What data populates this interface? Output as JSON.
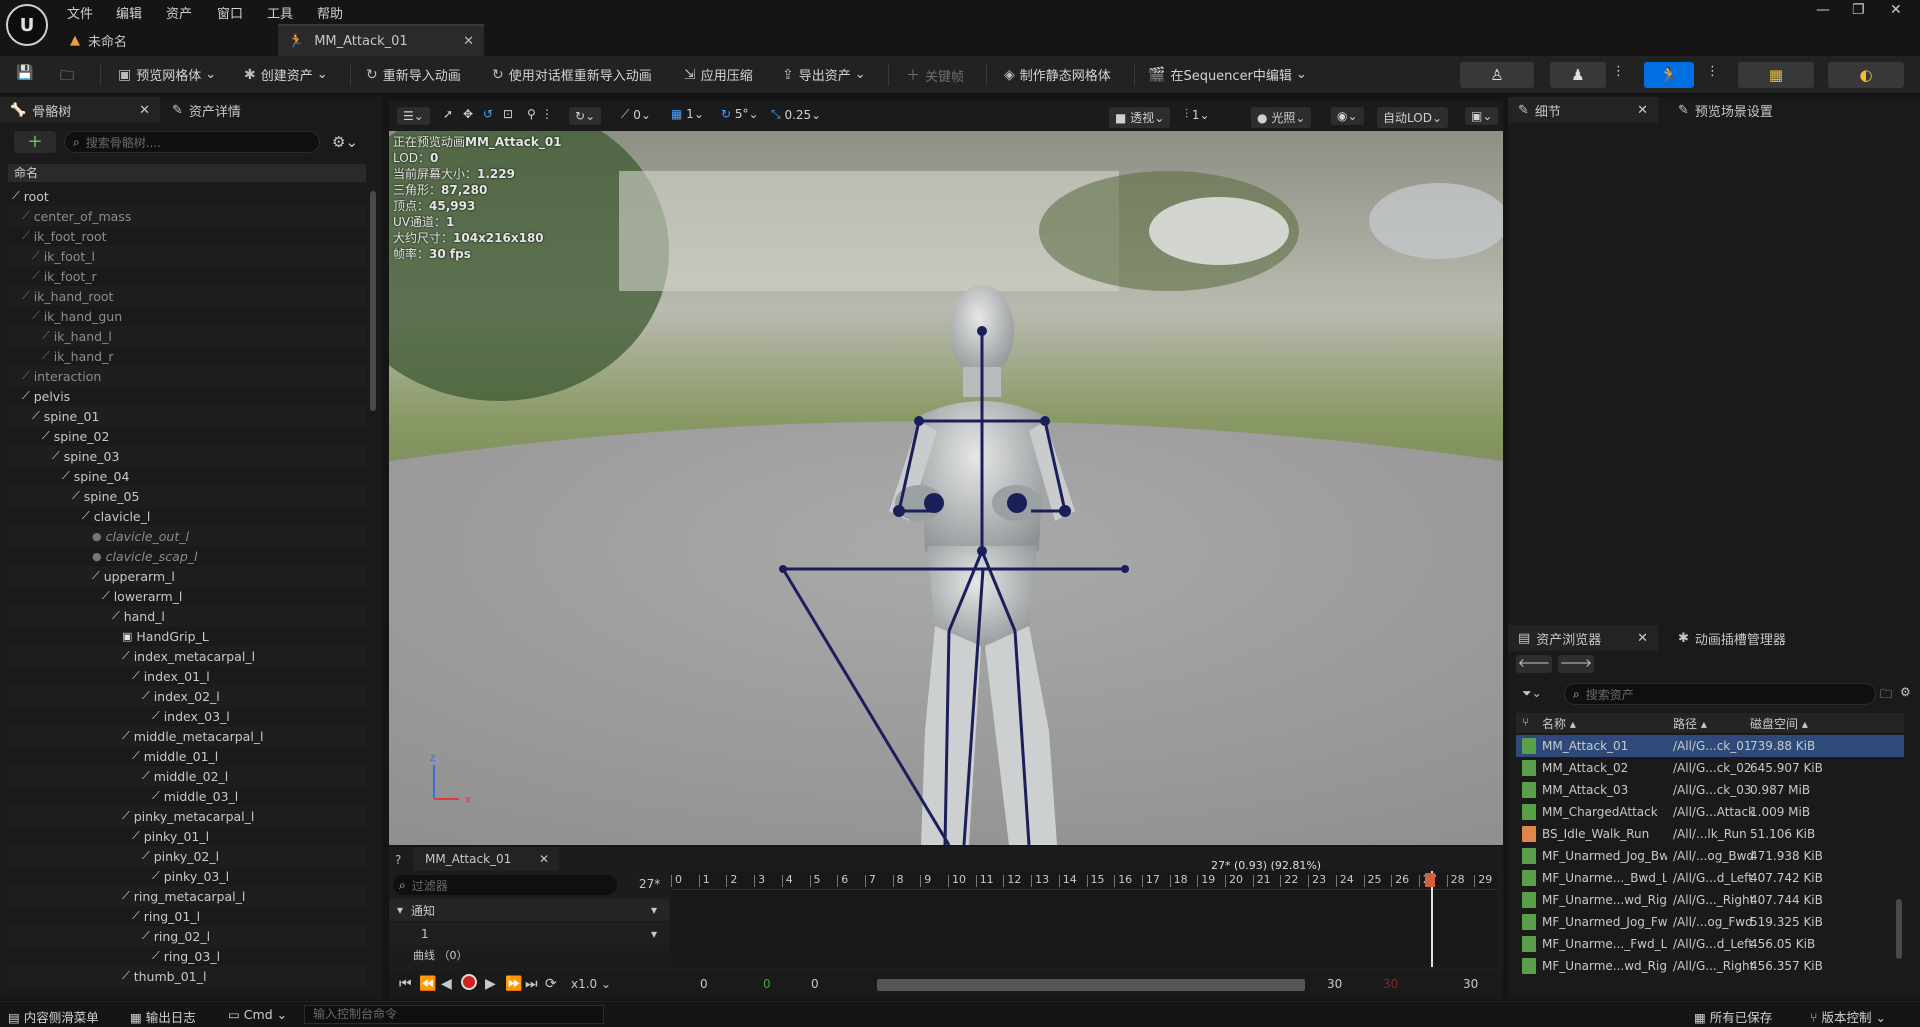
{
  "menu": [
    "文件",
    "编辑",
    "资产",
    "窗口",
    "工具",
    "帮助"
  ],
  "tabs": {
    "untitled": "未命名",
    "asset": "MM_Attack_01"
  },
  "toolbar": {
    "preview_mesh": "预览网格体",
    "create_asset": "创建资产",
    "reimport": "重新导入动画",
    "reimport_dialog": "使用对话框重新导入动画",
    "apply_compression": "应用压缩",
    "export_asset": "导出资产",
    "keyframe": "关键帧",
    "make_static_mesh": "制作静态网格体",
    "edit_sequencer": "在Sequencer中编辑"
  },
  "left_panel": {
    "tab_skeleton": "骨骼树",
    "tab_asset_details": "资产详情",
    "search_placeholder": "搜索骨骼树....",
    "column_name": "命名",
    "bones": [
      {
        "name": "root",
        "depth": 0,
        "style": "bone"
      },
      {
        "name": "center_of_mass",
        "depth": 1,
        "style": "grey"
      },
      {
        "name": "ik_foot_root",
        "depth": 1,
        "style": "grey"
      },
      {
        "name": "ik_foot_l",
        "depth": 2,
        "style": "grey"
      },
      {
        "name": "ik_foot_r",
        "depth": 2,
        "style": "grey"
      },
      {
        "name": "ik_hand_root",
        "depth": 1,
        "style": "grey"
      },
      {
        "name": "ik_hand_gun",
        "depth": 2,
        "style": "grey"
      },
      {
        "name": "ik_hand_l",
        "depth": 3,
        "style": "grey"
      },
      {
        "name": "ik_hand_r",
        "depth": 3,
        "style": "grey"
      },
      {
        "name": "interaction",
        "depth": 1,
        "style": "grey"
      },
      {
        "name": "pelvis",
        "depth": 1,
        "style": "bone"
      },
      {
        "name": "spine_01",
        "depth": 2,
        "style": "bone"
      },
      {
        "name": "spine_02",
        "depth": 3,
        "style": "bone"
      },
      {
        "name": "spine_03",
        "depth": 4,
        "style": "bone"
      },
      {
        "name": "spine_04",
        "depth": 5,
        "style": "bone"
      },
      {
        "name": "spine_05",
        "depth": 6,
        "style": "bone"
      },
      {
        "name": "clavicle_l",
        "depth": 7,
        "style": "bone"
      },
      {
        "name": "clavicle_out_l",
        "depth": 8,
        "style": "ital"
      },
      {
        "name": "clavicle_scap_l",
        "depth": 8,
        "style": "ital"
      },
      {
        "name": "upperarm_l",
        "depth": 8,
        "style": "bone"
      },
      {
        "name": "lowerarm_l",
        "depth": 9,
        "style": "bone"
      },
      {
        "name": "hand_l",
        "depth": 10,
        "style": "bone"
      },
      {
        "name": "HandGrip_L",
        "depth": 11,
        "style": "socket"
      },
      {
        "name": "index_metacarpal_l",
        "depth": 11,
        "style": "bone"
      },
      {
        "name": "index_01_l",
        "depth": 12,
        "style": "bone"
      },
      {
        "name": "index_02_l",
        "depth": 13,
        "style": "bone"
      },
      {
        "name": "index_03_l",
        "depth": 14,
        "style": "bone"
      },
      {
        "name": "middle_metacarpal_l",
        "depth": 11,
        "style": "bone"
      },
      {
        "name": "middle_01_l",
        "depth": 12,
        "style": "bone"
      },
      {
        "name": "middle_02_l",
        "depth": 13,
        "style": "bone"
      },
      {
        "name": "middle_03_l",
        "depth": 14,
        "style": "bone"
      },
      {
        "name": "pinky_metacarpal_l",
        "depth": 11,
        "style": "bone"
      },
      {
        "name": "pinky_01_l",
        "depth": 12,
        "style": "bone"
      },
      {
        "name": "pinky_02_l",
        "depth": 13,
        "style": "bone"
      },
      {
        "name": "pinky_03_l",
        "depth": 14,
        "style": "bone"
      },
      {
        "name": "ring_metacarpal_l",
        "depth": 11,
        "style": "bone"
      },
      {
        "name": "ring_01_l",
        "depth": 12,
        "style": "bone"
      },
      {
        "name": "ring_02_l",
        "depth": 13,
        "style": "bone"
      },
      {
        "name": "ring_03_l",
        "depth": 14,
        "style": "bone"
      },
      {
        "name": "thumb_01_l",
        "depth": 11,
        "style": "bone"
      }
    ]
  },
  "viewport_toolbar": {
    "rot_snap_val": "0",
    "grid_val": "1",
    "angle_val": "5°",
    "scale_val": "0.25",
    "perspective": "透视",
    "lod_count": "1",
    "lighting": "光照",
    "auto_lod": "自动LOD"
  },
  "viewport_stats": [
    {
      "label": "正在预览动画",
      "value": "MM_Attack_01"
    },
    {
      "label": "LOD：",
      "value": "0"
    },
    {
      "label": "当前屏幕大小：",
      "value": "1.229"
    },
    {
      "label": "三角形：",
      "value": "87,280"
    },
    {
      "label": "顶点：",
      "value": "45,993"
    },
    {
      "label": "UV通道：",
      "value": "1"
    },
    {
      "label": "大约尺寸：",
      "value": "104x216x180"
    },
    {
      "label": "帧率：",
      "value": "30 fps"
    }
  ],
  "timeline": {
    "tab": "MM_Attack_01",
    "filter_placeholder": "过滤器",
    "frame_field": "27",
    "notify": "通知",
    "notify_track": "1",
    "curves": "曲线 （0）",
    "current": "27* (0.93) (92.81%)",
    "ticks": [
      "0",
      "1",
      "2",
      "3",
      "4",
      "5",
      "6",
      "7",
      "8",
      "9",
      "10",
      "11",
      "12",
      "13",
      "14",
      "15",
      "16",
      "17",
      "18",
      "19",
      "20",
      "21",
      "22",
      "23",
      "24",
      "25",
      "26",
      "27",
      "28",
      "29"
    ],
    "speed": "x1.0",
    "start_a": "0",
    "start_b": "0",
    "start_c": "0",
    "end_a": "30",
    "end_b": "30",
    "end_c": "30"
  },
  "right_panel": {
    "tab_details": "细节",
    "tab_preview_scene": "预览场景设置"
  },
  "asset_browser": {
    "tab": "资产浏览器",
    "tab_notify": "动画插槽管理器",
    "search_placeholder": "搜索资产",
    "columns": {
      "name": "名称",
      "path": "路径",
      "size": "磁盘空间"
    },
    "rows": [
      {
        "name": "MM_Attack_01",
        "path": "/All/G...ck_01",
        "size": "739.88 KiB",
        "type": "anim",
        "selected": true
      },
      {
        "name": "MM_Attack_02",
        "path": "/All/G...ck_02",
        "size": "645.907 KiB",
        "type": "anim"
      },
      {
        "name": "MM_Attack_03",
        "path": "/All/G...ck_03",
        "size": "0.987 MiB",
        "type": "anim"
      },
      {
        "name": "MM_ChargedAttack",
        "path": "/All/G...Attack",
        "size": "1.009 MiB",
        "type": "anim"
      },
      {
        "name": "BS_Idle_Walk_Run",
        "path": "/All/...lk_Run",
        "size": "51.106 KiB",
        "type": "blend"
      },
      {
        "name": "MF_Unarmed_Jog_Bwd",
        "path": "/All/...og_Bwd",
        "size": "471.938 KiB",
        "type": "anim"
      },
      {
        "name": "MF_Unarme..._Bwd_Left",
        "path": "/All/G...d_Left",
        "size": "407.742 KiB",
        "type": "anim"
      },
      {
        "name": "MF_Unarme...wd_Right",
        "path": "/All/G..._Right",
        "size": "407.744 KiB",
        "type": "anim"
      },
      {
        "name": "MF_Unarmed_Jog_Fwd",
        "path": "/All/...og_Fwd",
        "size": "519.325 KiB",
        "type": "anim"
      },
      {
        "name": "MF_Unarme..._Fwd_Left",
        "path": "/All/G...d_Left",
        "size": "456.05 KiB",
        "type": "anim"
      },
      {
        "name": "MF_Unarme...wd_Right",
        "path": "/All/G..._Right",
        "size": "456.357 KiB",
        "type": "anim"
      }
    ]
  },
  "statusbar": {
    "content_drawer": "内容侧滑菜单",
    "output_log": "输出日志",
    "cmd": "Cmd",
    "console_placeholder": "输入控制台命令",
    "all_saved": "所有已保存",
    "source_control": "版本控制"
  },
  "colors": {
    "accent": "#0070e0",
    "bone_line": "#1a1f5a",
    "selected_row": "#2f4a7a"
  }
}
